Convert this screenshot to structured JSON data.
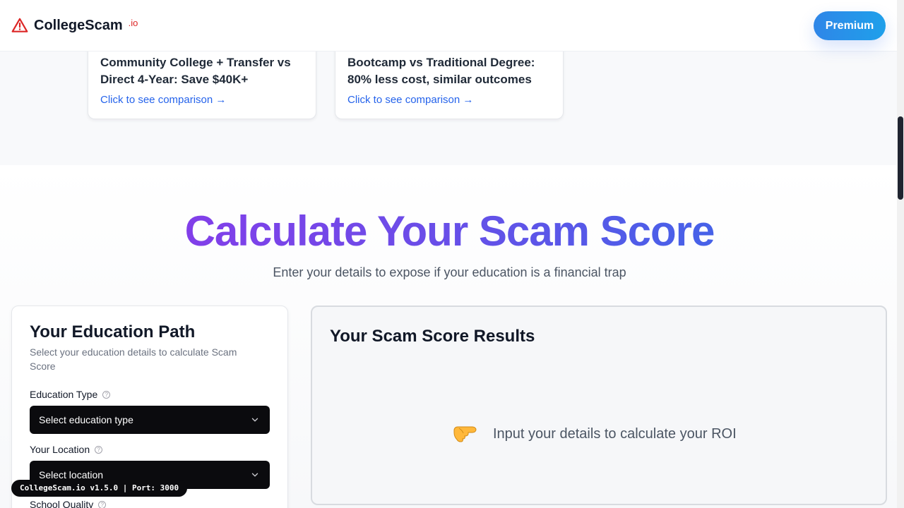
{
  "header": {
    "brand": "CollegeScam",
    "brand_tld": ".io",
    "premium_label": "Premium"
  },
  "comparisons": [
    {
      "title": "Community College + Transfer vs Direct 4-Year: Save $40K+",
      "link": "Click to see comparison →"
    },
    {
      "title": "Bootcamp vs Traditional Degree: 80% less cost, similar outcomes",
      "link": "Click to see comparison →"
    }
  ],
  "calculator": {
    "title": "Calculate Your Scam Score",
    "subtitle": "Enter your details to expose if your education is a financial trap"
  },
  "form": {
    "title": "Your Education Path",
    "description": "Select your education details to calculate Scam Score",
    "education_type_label": "Education Type",
    "education_type_value": "Select education type",
    "location_label": "Your Location",
    "location_value": "Select location",
    "school_quality_label": "School Quality"
  },
  "results": {
    "title": "Your Scam Score Results",
    "empty_message": "Input your details to calculate your ROI",
    "empty_icon": "pointing-hand-icon"
  },
  "footer": {
    "version": "CollegeScam.io v1.5.0 | Port: 3000"
  },
  "colors": {
    "brand_red": "#dc2626",
    "link_blue": "#2563eb",
    "title_gradient_start": "#9333ea",
    "title_gradient_end": "#2f6fe8",
    "premium_gradient_start": "#2f86e8",
    "premium_gradient_end": "#1fa0ea",
    "select_background": "#0b0b0e"
  }
}
